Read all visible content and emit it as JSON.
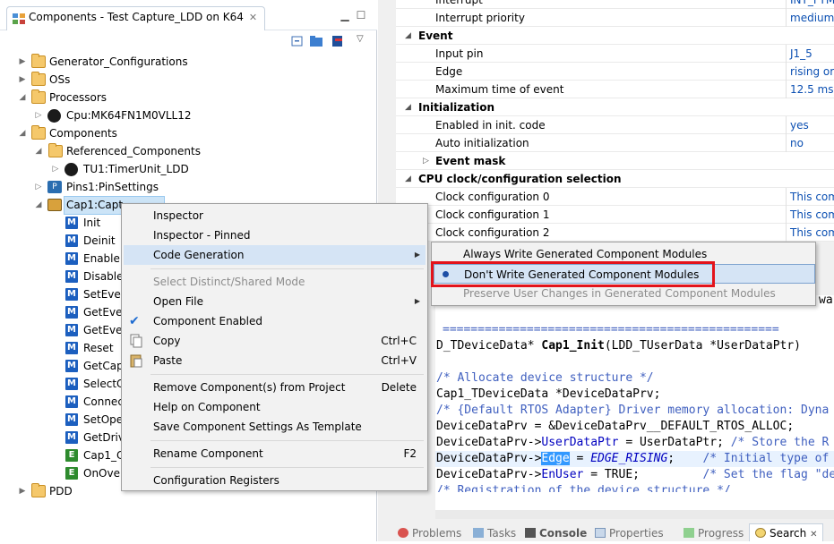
{
  "left_panel": {
    "tab_title": "Components - Test Capture_LDD on K64",
    "tree": [
      {
        "label": "Generator_Configurations"
      },
      {
        "label": "OSs"
      },
      {
        "label": "Processors"
      },
      {
        "label": "Cpu:MK64FN1M0VLL12"
      },
      {
        "label": "Components"
      },
      {
        "label": "Referenced_Components"
      },
      {
        "label": "TU1:TimerUnit_LDD"
      },
      {
        "label": "Pins1:PinSettings"
      },
      {
        "label": "Cap1:Capt"
      },
      {
        "label": "Init"
      },
      {
        "label": "Deinit"
      },
      {
        "label": "Enable"
      },
      {
        "label": "Disable"
      },
      {
        "label": "SetEver"
      },
      {
        "label": "GetEver"
      },
      {
        "label": "GetEver"
      },
      {
        "label": "Reset"
      },
      {
        "label": "GetCap"
      },
      {
        "label": "SelectC"
      },
      {
        "label": "Connec"
      },
      {
        "label": "SetOpe"
      },
      {
        "label": "GetDriv"
      },
      {
        "label": "Cap1_C"
      },
      {
        "label": "OnOver"
      },
      {
        "label": "PDD"
      }
    ]
  },
  "properties": {
    "rows": [
      {
        "name": "Interrupt",
        "value": "INT_FTM"
      },
      {
        "name": "Interrupt priority",
        "value": "medium"
      },
      {
        "name": "Event",
        "value": ""
      },
      {
        "name": "Input pin",
        "value": "J1_5"
      },
      {
        "name": "Edge",
        "value": "rising or"
      },
      {
        "name": "Maximum time of event",
        "value": "12.5 ms"
      },
      {
        "name": "Initialization",
        "value": ""
      },
      {
        "name": "Enabled in init. code",
        "value": "yes"
      },
      {
        "name": "Auto initialization",
        "value": "no"
      },
      {
        "name": "Event mask",
        "value": ""
      },
      {
        "name": "CPU clock/configuration selection",
        "value": ""
      },
      {
        "name": "Clock configuration 0",
        "value": "This com"
      },
      {
        "name": "Clock configuration 1",
        "value": "This com"
      },
      {
        "name": "Clock configuration 2",
        "value": "This com"
      }
    ]
  },
  "code": {
    "wa": "wa",
    "separator": "================================================",
    "l1a": "D_TDeviceData* ",
    "l1b": "Cap1_Init",
    "l1c": "(LDD_TUserData *UserDataPtr)",
    "l2": "/* Allocate device structure */",
    "l3": "Cap1_TDeviceData *DeviceDataPrv;",
    "l4": "/* {Default RTOS Adapter} Driver memory allocation: Dyna",
    "l5": "DeviceDataPrv = &DeviceDataPrv__DEFAULT_RTOS_ALLOC;",
    "l6a": "DeviceDataPrv->",
    "l6b": "UserDataPtr",
    "l6c": " = UserDataPtr; ",
    "l6d": "/* Store the R",
    "l7a": "DeviceDataPrv->",
    "l7b": "Edge",
    "l7c": " = ",
    "l7d": "EDGE_RISING",
    "l7e": ";    ",
    "l7f": "/* Initial type of",
    "l8a": "DeviceDataPrv->",
    "l8b": "EnUser",
    "l8c": " = TRUE;         ",
    "l8d": "/* Set the flag \"de",
    "l9": "/* Registration of the device structure */"
  },
  "bottom_tabs": {
    "problems": "Problems",
    "tasks": "Tasks",
    "console": "Console",
    "properties": "Properties",
    "progress": "Progress",
    "search": "Search"
  },
  "context_menu": {
    "inspector": "Inspector",
    "inspector_pinned": "Inspector - Pinned",
    "code_generation": "Code Generation",
    "select_distinct": "Select Distinct/Shared Mode",
    "open_file": "Open File",
    "component_enabled": "Component Enabled",
    "copy": "Copy",
    "copy_key": "Ctrl+C",
    "paste": "Paste",
    "paste_key": "Ctrl+V",
    "remove": "Remove Component(s) from Project",
    "remove_key": "Delete",
    "help": "Help on Component",
    "save_template": "Save Component Settings As Template",
    "rename": "Rename Component",
    "rename_key": "F2",
    "config_registers": "Configuration Registers"
  },
  "submenu": {
    "always_write": "Always Write Generated Component Modules",
    "dont_write": "Don't Write Generated Component Modules",
    "preserve": "Preserve User Changes in Generated Component Modules"
  }
}
